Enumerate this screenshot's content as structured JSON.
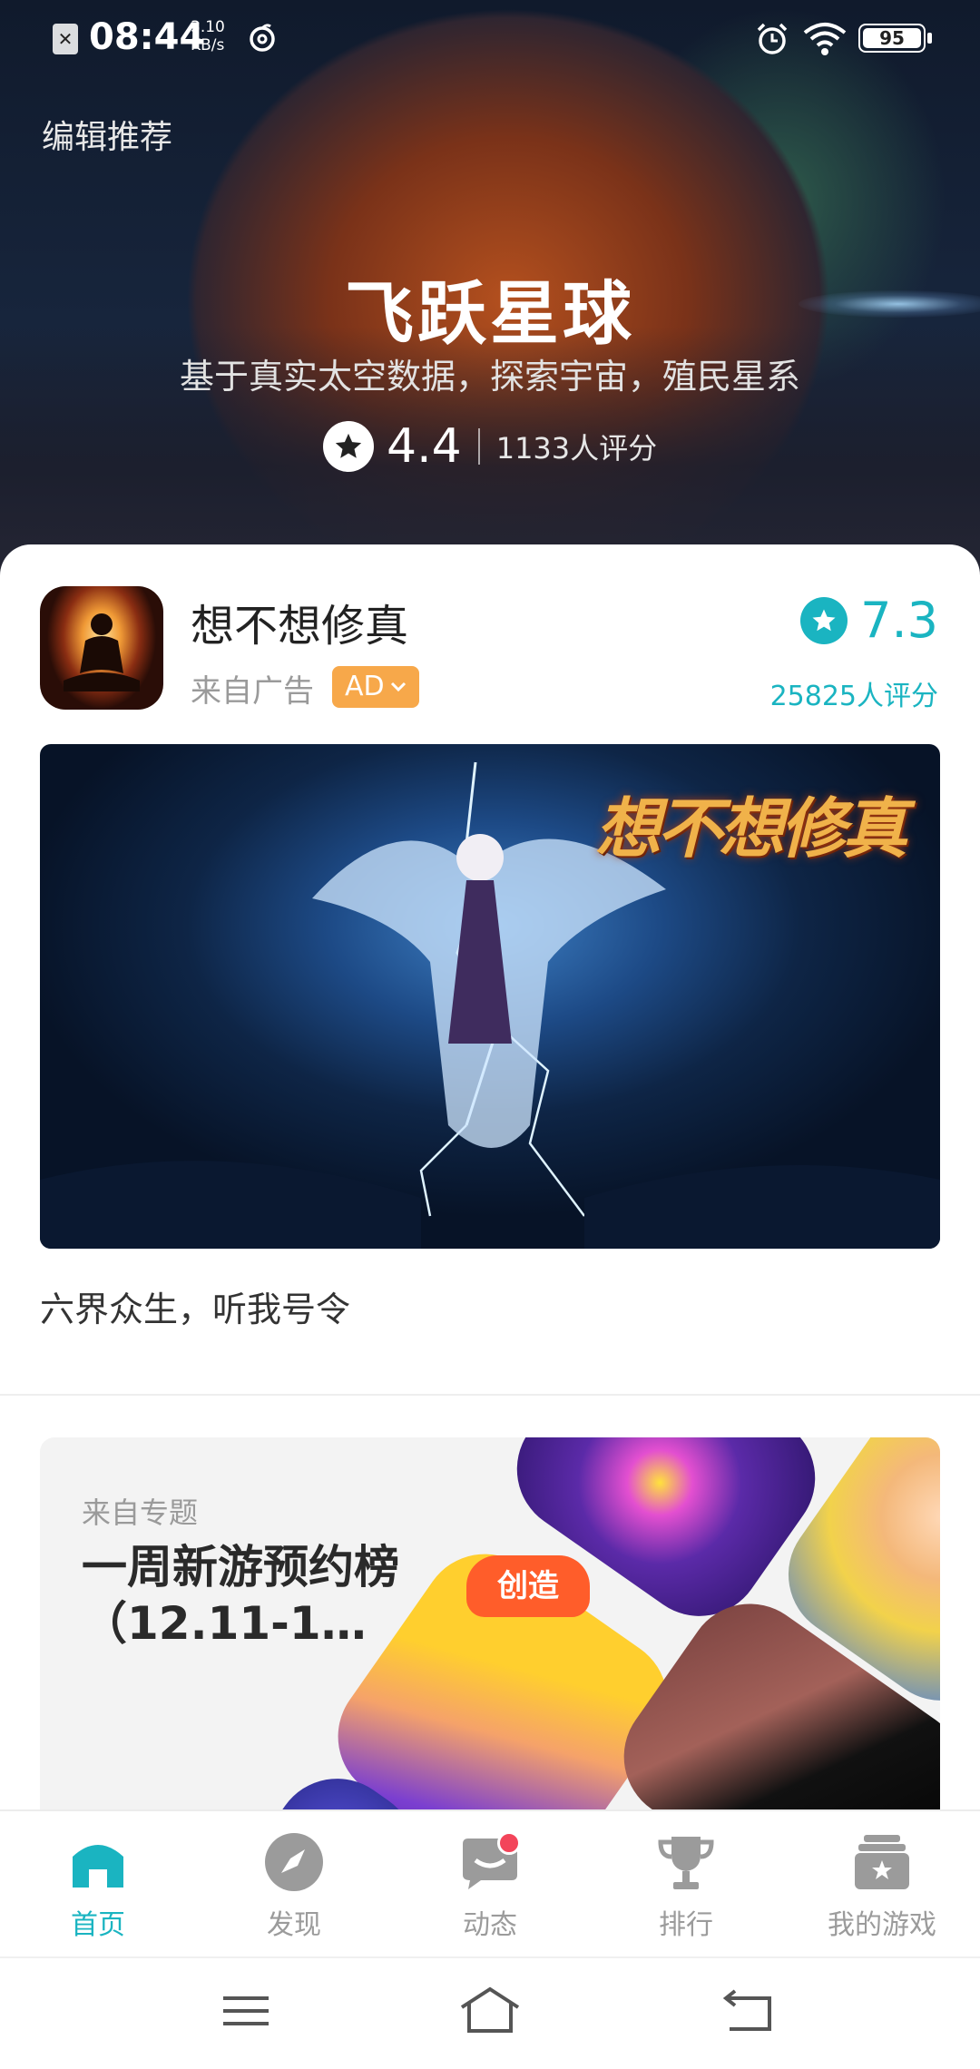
{
  "status_bar": {
    "time": "08:44",
    "net_speed_value": "3.10",
    "net_speed_unit": "KB/s",
    "battery": "95",
    "sim_icon": "sim-missing-icon",
    "extra_icons": [
      "netease-music-icon",
      "alarm-icon",
      "wifi-icon",
      "battery-icon"
    ]
  },
  "hero": {
    "label": "编辑推荐",
    "title": "飞跃星球",
    "subtitle": "基于真实太空数据，探索宇宙，殖民星系",
    "score": "4.4",
    "rating_count": "1133人评分"
  },
  "app_card": {
    "name": "想不想修真",
    "source": "来自广告",
    "ad_label": "AD",
    "score": "7.3",
    "rating_count": "25825人评分",
    "banner_logo": "想不想修真",
    "description": "六界众生，听我号令"
  },
  "topic_card": {
    "source": "来自专题",
    "title": "一周新游预约榜（12.11-1…",
    "badge": "创造"
  },
  "bottom_nav": {
    "items": [
      {
        "label": "首页",
        "icon": "home-icon",
        "active": true
      },
      {
        "label": "发现",
        "icon": "compass-icon",
        "active": false
      },
      {
        "label": "动态",
        "icon": "chat-icon",
        "active": false
      },
      {
        "label": "排行",
        "icon": "trophy-icon",
        "active": false
      },
      {
        "label": "我的游戏",
        "icon": "game-box-icon",
        "active": false
      }
    ]
  },
  "colors": {
    "accent": "#1ab4c1",
    "ad_badge": "#f7a84a",
    "notification_dot": "#f3455a"
  }
}
